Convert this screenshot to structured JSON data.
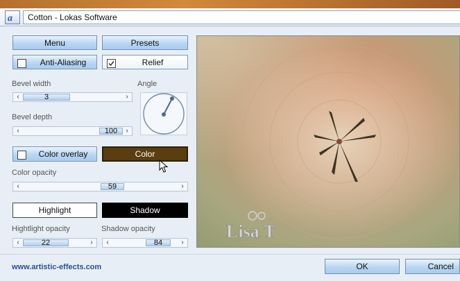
{
  "window": {
    "title": "Cotton - Lokas Software"
  },
  "buttons": {
    "menu": "Menu",
    "presets": "Presets",
    "color": "Color",
    "highlight": "Highlight",
    "shadow": "Shadow",
    "ok": "OK",
    "cancel": "Cancel"
  },
  "checkboxes": {
    "anti_aliasing": {
      "label": "Anti-Aliasing",
      "checked": false
    },
    "relief": {
      "label": "Relief",
      "checked": true
    },
    "color_overlay": {
      "label": "Color overlay",
      "checked": false
    }
  },
  "labels": {
    "bevel_width": "Bevel width",
    "bevel_depth": "Bevel depth",
    "angle": "Angle",
    "color_opacity": "Color opacity",
    "highlight_opacity": "Hightlight opacity",
    "shadow_opacity": "Shadow opacity"
  },
  "values": {
    "bevel_width": "3",
    "bevel_depth": "100",
    "color_opacity": "59",
    "highlight_opacity": "22",
    "shadow_opacity": "84"
  },
  "watermark": "Lisa T",
  "website": "www.artistic-effects.com",
  "colors": {
    "color_swatch": "#5a3e0f",
    "highlight": "#ffffff",
    "shadow": "#000000",
    "link": "#2a4f95"
  }
}
